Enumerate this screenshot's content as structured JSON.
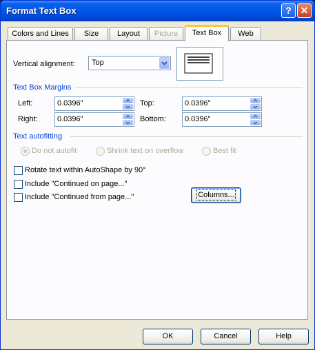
{
  "window": {
    "title": "Format Text Box"
  },
  "tabs": [
    {
      "label": "Colors and Lines",
      "state": "normal"
    },
    {
      "label": "Size",
      "state": "normal"
    },
    {
      "label": "Layout",
      "state": "normal"
    },
    {
      "label": "Picture",
      "state": "disabled"
    },
    {
      "label": "Text Box",
      "state": "active"
    },
    {
      "label": "Web",
      "state": "normal"
    }
  ],
  "vertical_alignment": {
    "label": "Vertical alignment:",
    "value": "Top"
  },
  "margins": {
    "group_label": "Text Box Margins",
    "left": {
      "label": "Left:",
      "value": "0.0396\""
    },
    "top": {
      "label": "Top:",
      "value": "0.0396\""
    },
    "right": {
      "label": "Right:",
      "value": "0.0396\""
    },
    "bottom": {
      "label": "Bottom:",
      "value": "0.0396\""
    }
  },
  "autofit": {
    "group_label": "Text autofitting",
    "options": [
      "Do not autofit",
      "Shrink text on overflow",
      "Best fit"
    ],
    "selected": "Do not autofit"
  },
  "checkboxes": [
    {
      "label": "Rotate text within AutoShape by 90°",
      "checked": false
    },
    {
      "label": "Include \"Continued on page...\"",
      "checked": false
    },
    {
      "label": "Include \"Continued from page...\"",
      "checked": false
    }
  ],
  "columns_button": "Columns...",
  "footer": {
    "ok": "OK",
    "cancel": "Cancel",
    "help": "Help"
  },
  "colors": {
    "title_bar": "#0058e6",
    "group_label": "#0046d5",
    "active_tab": "#ffc83c"
  }
}
